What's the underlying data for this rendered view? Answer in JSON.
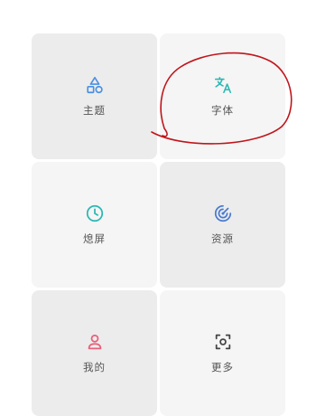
{
  "tiles": [
    {
      "label": "主题",
      "icon": "shapes-icon",
      "color": "#4a90e2"
    },
    {
      "label": "字体",
      "icon": "translate-icon",
      "color": "#2bb7b3"
    },
    {
      "label": "熄屏",
      "icon": "clock-icon",
      "color": "#2bb7b3"
    },
    {
      "label": "资源",
      "icon": "target-icon",
      "color": "#4a7bd0"
    },
    {
      "label": "我的",
      "icon": "person-icon",
      "color": "#e8607a"
    },
    {
      "label": "更多",
      "icon": "scan-icon",
      "color": "#444444"
    }
  ],
  "annotation": {
    "color": "#c0151b"
  }
}
